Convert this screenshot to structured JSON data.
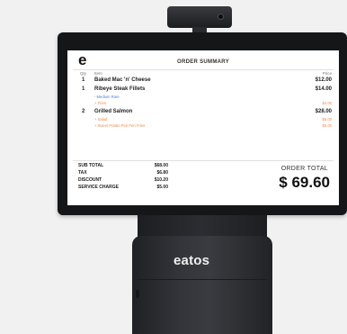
{
  "device": {
    "brand_label": "eatos"
  },
  "screen": {
    "logo": "e",
    "title": "ORDER SUMMARY",
    "columns": {
      "qty": "Qty",
      "item": "Item",
      "price": "Price"
    },
    "items": [
      {
        "qty": "1",
        "name": "Baked Mac 'n' Cheese",
        "price": "$12.00",
        "modifiers": []
      },
      {
        "qty": "1",
        "name": "Ribeye Steak Fillets",
        "price": "$14.00",
        "modifiers": [
          {
            "name": "- Medium Rare",
            "price": ""
          },
          {
            "name": "+ Fries",
            "price": "$4.00"
          }
        ]
      },
      {
        "qty": "2",
        "name": "Grilled Salmon",
        "price": "$28.00",
        "modifiers": [
          {
            "name": "+ Salad",
            "price": "$5.00"
          },
          {
            "name": "+ Sweet Potato Peri Peri Fries",
            "price": "$5.00"
          }
        ]
      }
    ],
    "summary": [
      {
        "label": "SUB TOTAL",
        "value": "$68.00"
      },
      {
        "label": "TAX",
        "value": "$6.80"
      },
      {
        "label": "DISCOUNT",
        "value": "$10.20"
      },
      {
        "label": "SERVICE CHARGE",
        "value": "$5.00"
      }
    ],
    "order_total_label": "ORDER TOTAL",
    "order_total_value": "$ 69.60"
  },
  "colors": {
    "modifier_remove": "#4a7fd6",
    "modifier_add": "#f08a4b",
    "bezel": "#151618",
    "background": "#f1f1f2"
  }
}
